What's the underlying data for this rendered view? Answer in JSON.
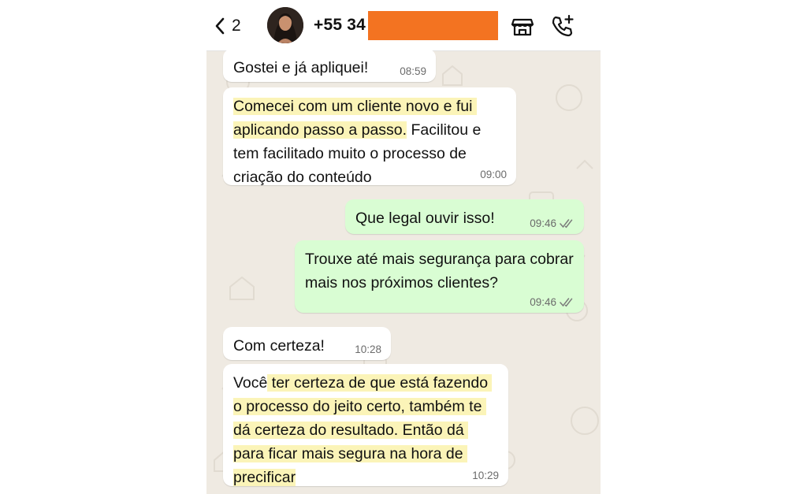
{
  "header": {
    "back_icon": "chevron-left-icon",
    "unread_count": "2",
    "contact_name": "+55 34",
    "icons": [
      "store-icon",
      "phone-add-icon"
    ]
  },
  "colors": {
    "incoming_bubble": "#ffffff",
    "outgoing_bubble": "#d9fdd3",
    "highlight": "#fbf4b8",
    "redaction": "#f37321",
    "chat_background": "#efeae2"
  },
  "messages": [
    {
      "direction": "incoming",
      "text": "Gostei e já apliquei!",
      "time": "08:59"
    },
    {
      "direction": "incoming",
      "text_highlighted": "Comecei com um cliente novo e fui aplicando passo a passo.",
      "text_rest": " Facilitou e tem facilitado muito o processo de criação do conteúdo",
      "time": "09:00"
    },
    {
      "direction": "outgoing",
      "text": "Que legal ouvir isso!",
      "time": "09:46",
      "status": "read"
    },
    {
      "direction": "outgoing",
      "text": "Trouxe até mais segurança para cobrar mais nos próximos clientes?",
      "time": "09:46",
      "status": "read"
    },
    {
      "direction": "incoming",
      "text": "Com certeza!",
      "time": "10:28"
    },
    {
      "direction": "incoming",
      "text_plain": "Você",
      "text_highlighted": " ter certeza de que está fazendo o processo do jeito certo, também te dá certeza do resultado. Então dá para ficar mais segura na hora de precificar",
      "time": "10:29"
    }
  ]
}
